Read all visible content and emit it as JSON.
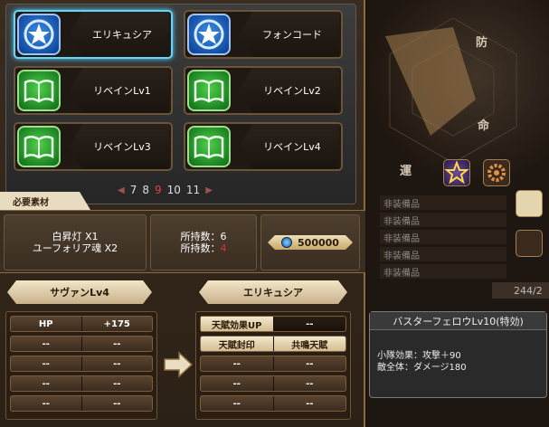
{
  "items": [
    {
      "label": "エリキュシア",
      "icon": "blue-star-icon",
      "selected": true
    },
    {
      "label": "フォンコード",
      "icon": "blue-star-icon",
      "selected": false
    },
    {
      "label": "リベインLv1",
      "icon": "green-book-icon",
      "selected": false
    },
    {
      "label": "リベインLv2",
      "icon": "green-book-icon",
      "selected": false
    },
    {
      "label": "リベインLv3",
      "icon": "green-book-icon",
      "selected": false
    },
    {
      "label": "リベインLv4",
      "icon": "green-book-icon",
      "selected": false
    }
  ],
  "pager": {
    "pages": [
      "7",
      "8",
      "9",
      "10",
      "11"
    ],
    "current": "9"
  },
  "materials": {
    "tab_label": "必要素材",
    "names": [
      "白昇灯 X1",
      "ユーフォリア魂 X2"
    ],
    "owned_label": "所持数：",
    "owned": [
      "6",
      "4"
    ],
    "cost": "500000"
  },
  "upgrade": {
    "from_name": "サヴァンLv4",
    "to_name": "エリキュシア",
    "from_stats": [
      [
        "HP",
        "+175"
      ],
      [
        "--",
        "--"
      ],
      [
        "--",
        "--"
      ],
      [
        "--",
        "--"
      ],
      [
        "--",
        "--"
      ]
    ],
    "to_stats": [
      [
        "天賦効果UP",
        "--"
      ],
      [
        "天賦封印",
        "共鳴天賦"
      ],
      [
        "--",
        "--"
      ],
      [
        "--",
        "--"
      ],
      [
        "--",
        "--"
      ]
    ]
  },
  "right": {
    "radar_labels": {
      "top": "防",
      "right": "命",
      "bottom": "運"
    },
    "list": [
      "非装備品",
      "非装備品",
      "非装備品",
      "非装備品",
      "非装備品"
    ],
    "counter": "244/2",
    "skill_title": "バスターフェロウLv10(特効)",
    "skill_desc": [
      "小隊効果：攻撃＋90",
      "敵全体：ダメージ180"
    ]
  },
  "colors": {
    "selected_border": "#5fd8ff",
    "owned_low": "#e03030",
    "page_current": "#e04040"
  }
}
